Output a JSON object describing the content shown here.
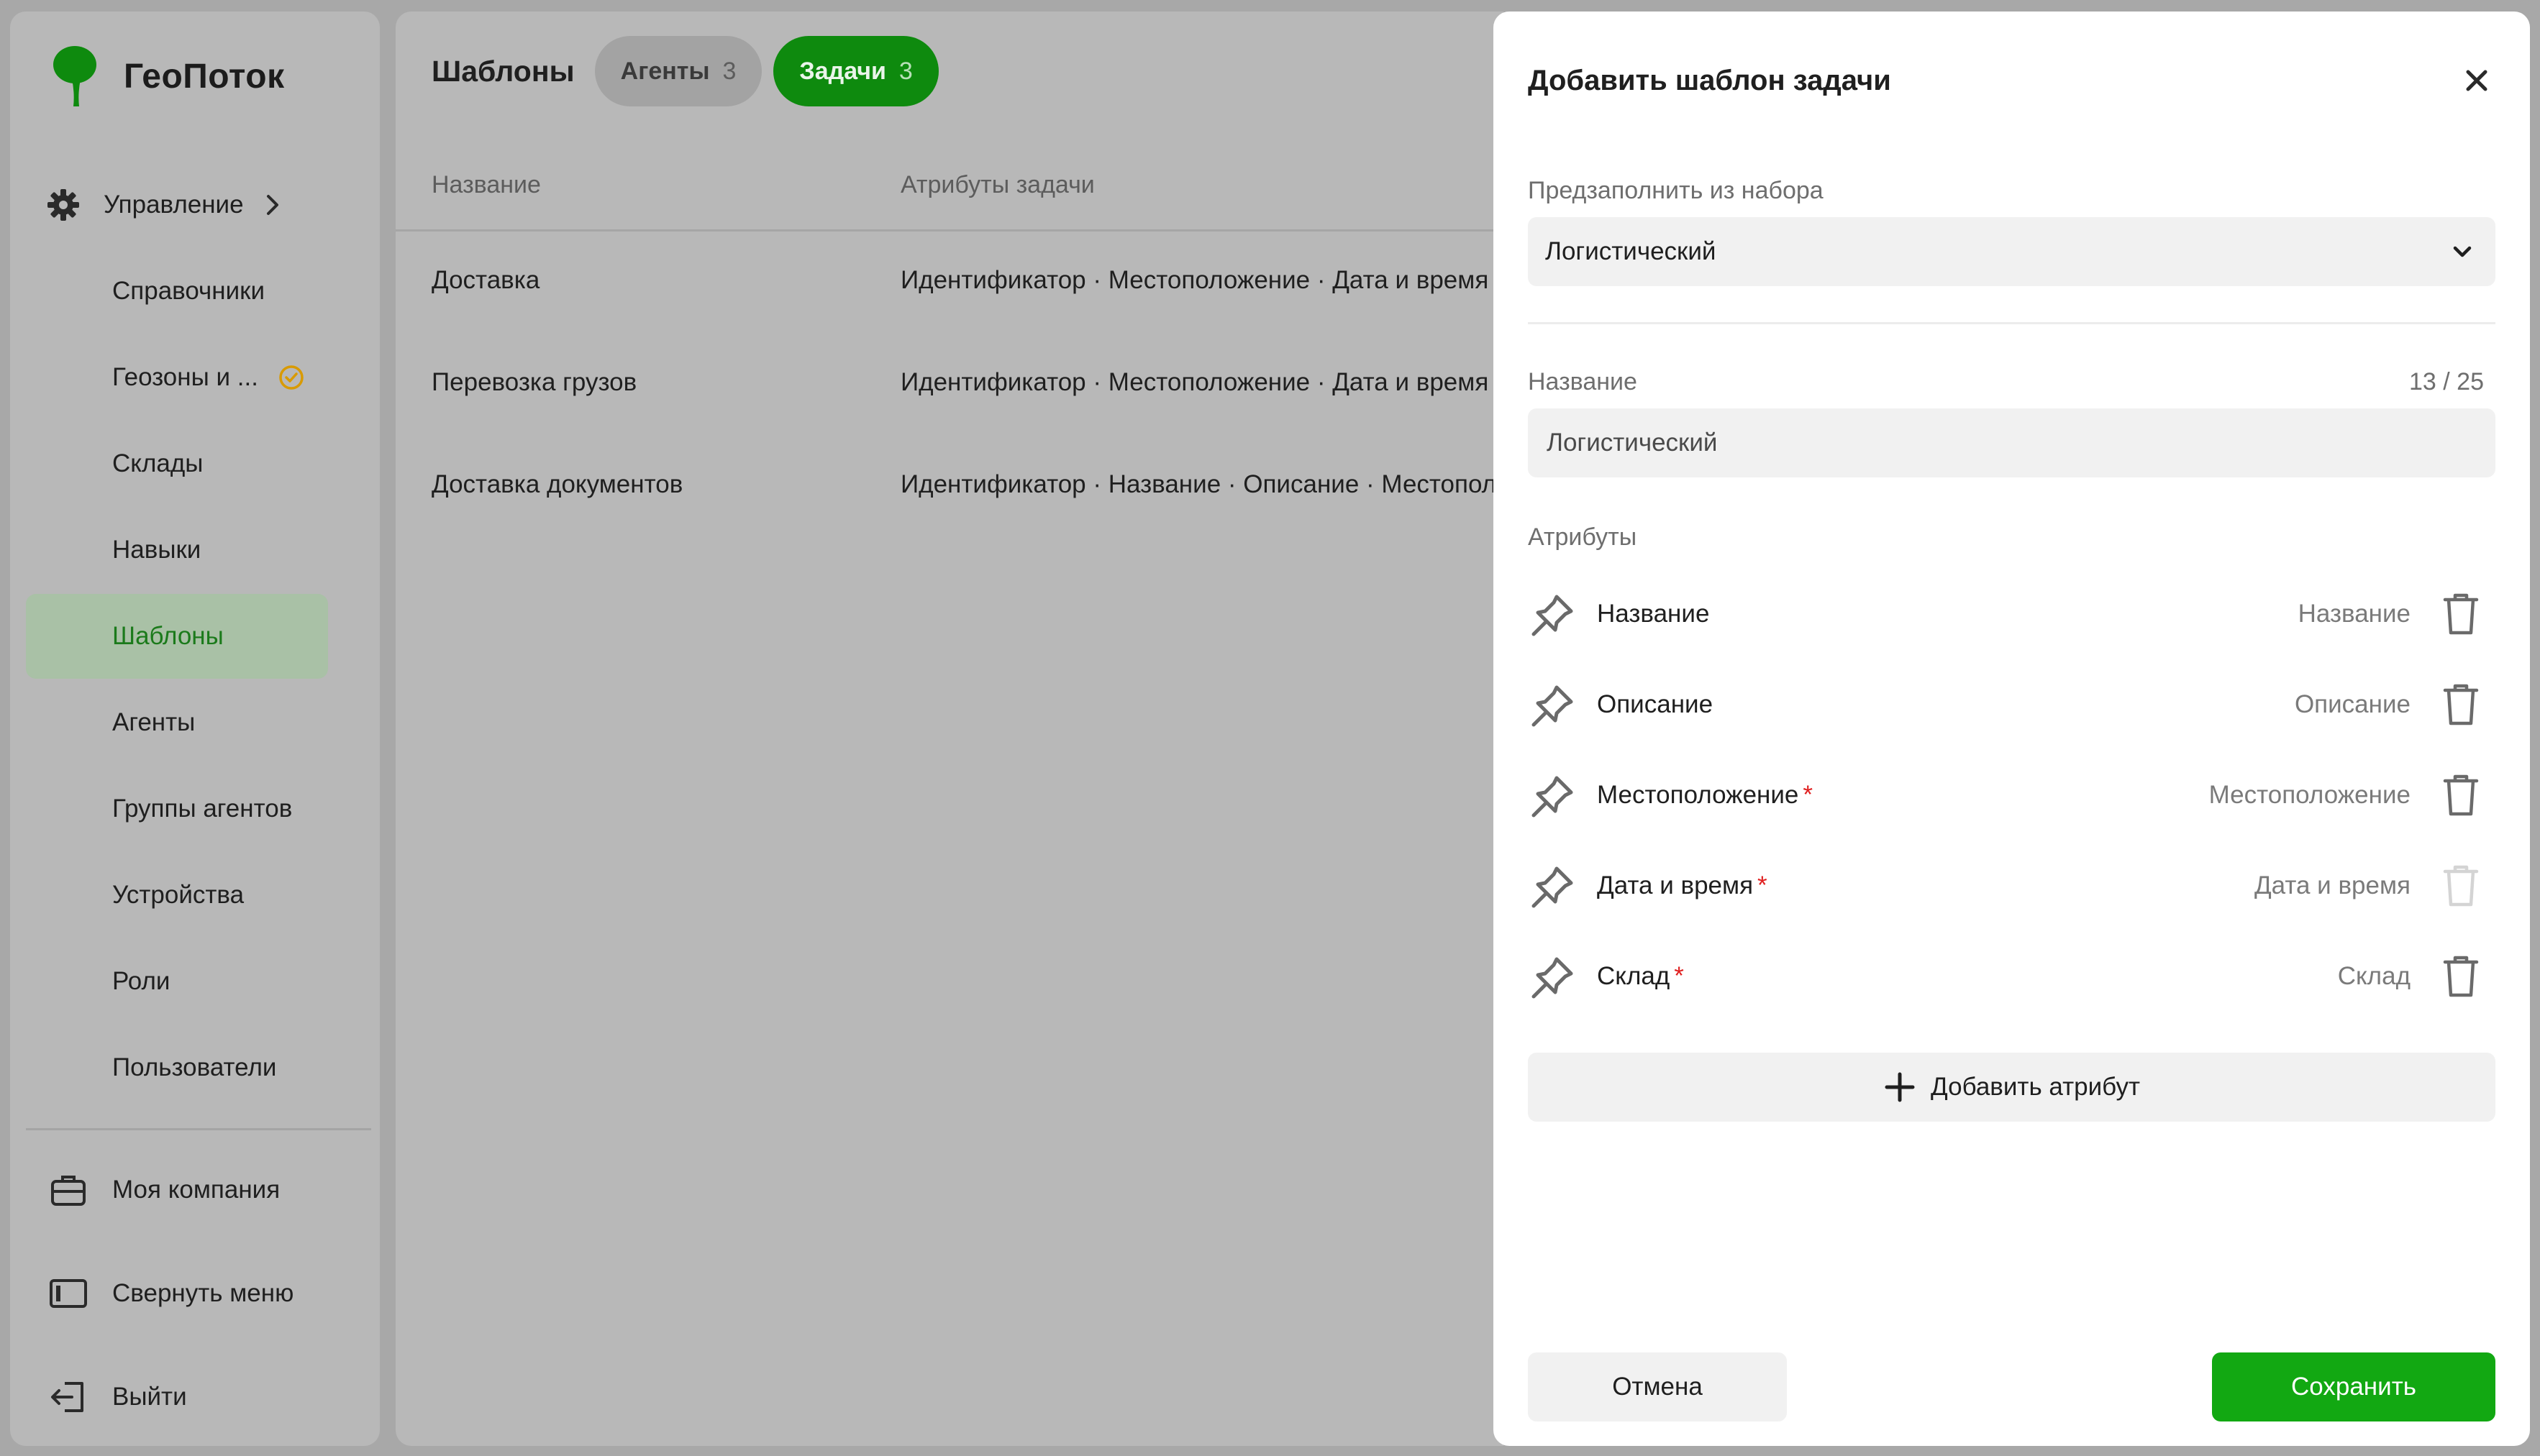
{
  "app": {
    "name": "ГеоПоток",
    "brand_color": "#0e8a0e"
  },
  "sidebar": {
    "section_label": "Управление",
    "items": [
      {
        "label": "Справочники"
      },
      {
        "label": "Геозоны и ..."
      },
      {
        "label": "Склады"
      },
      {
        "label": "Навыки"
      },
      {
        "label": "Шаблоны"
      },
      {
        "label": "Агенты"
      },
      {
        "label": "Группы агентов"
      },
      {
        "label": "Устройства"
      },
      {
        "label": "Роли"
      },
      {
        "label": "Пользователи"
      }
    ],
    "active_item": "Шаблоны",
    "company": "Моя компания",
    "collapse": "Свернуть меню",
    "logout": "Выйти",
    "warning_color": "#d99a00"
  },
  "main": {
    "title": "Шаблоны",
    "tabs": [
      {
        "label": "Агенты",
        "count": "3"
      },
      {
        "label": "Задачи",
        "count": "3"
      }
    ],
    "columns": [
      "Название",
      "Атрибуты задачи"
    ],
    "rows": [
      {
        "name": "Доставка",
        "attrs": "Идентификатор · Местоположение · Дата и время"
      },
      {
        "name": "Перевозка грузов",
        "attrs": "Идентификатор · Местоположение · Дата и время"
      },
      {
        "name": "Доставка документов",
        "attrs": "Идентификатор · Название · Описание · Местоположение"
      }
    ]
  },
  "dialog": {
    "title": "Добавить шаблон задачи",
    "prefill_label": "Предзаполнить из набора",
    "prefill_value": "Логистический",
    "name_label": "Название",
    "name_counter": "13 / 25",
    "name_value": "Логистический",
    "attributes_label": "Атрибуты",
    "attributes": [
      {
        "name": "Название",
        "required": false,
        "type": "Название",
        "required_mark": ""
      },
      {
        "name": "Описание",
        "required": false,
        "type": "Описание",
        "required_mark": ""
      },
      {
        "name": "Местоположение",
        "required": true,
        "type": "Местоположение",
        "required_mark": "*"
      },
      {
        "name": "Дата и время",
        "required": true,
        "type": "Дата и время",
        "required_mark": "*"
      },
      {
        "name": "Склад",
        "required": true,
        "type": "Склад",
        "required_mark": "*"
      }
    ],
    "add_attribute": "Добавить атрибут",
    "cancel": "Отмена",
    "save": "Сохранить",
    "save_color": "#12a812"
  }
}
